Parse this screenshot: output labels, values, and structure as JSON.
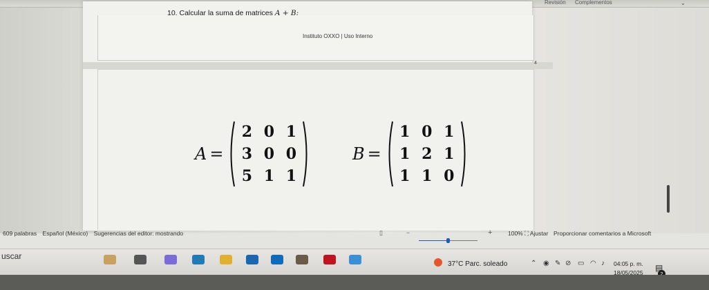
{
  "ribbon": {
    "tabs": [
      "Revisión",
      "Complementos"
    ]
  },
  "document": {
    "question": "10. Calcular la suma de matrices ",
    "question_math": "A + B:",
    "footer": "Instituto OXXO | Uso Interno",
    "page_number": "4",
    "matrices": [
      {
        "name": "A",
        "eq": "=",
        "rows": [
          [
            "2",
            "0",
            "1"
          ],
          [
            "3",
            "0",
            "0"
          ],
          [
            "5",
            "1",
            "1"
          ]
        ]
      },
      {
        "name": "B",
        "eq": "=",
        "rows": [
          [
            "1",
            "0",
            "1"
          ],
          [
            "1",
            "2",
            "1"
          ],
          [
            "1",
            "1",
            "0"
          ]
        ]
      }
    ]
  },
  "statusbar": {
    "words": "609 palabras",
    "language": "Español (México)",
    "editor": "Sugerencias del editor: mostrando",
    "zoom_minus": "−",
    "zoom_plus": "+",
    "zoom_level": 1.0,
    "zoom": "100%",
    "fit": "⛶ Ajustar",
    "feedback": "Proporcionar comentarios a Microsoft"
  },
  "taskbar": {
    "search": "uscar",
    "weather_temp": "37°C",
    "weather_desc": "Parc. soleado",
    "time": "04:05 p. m.",
    "date": "18/05/2025",
    "notification_count": "2",
    "apps": [
      {
        "icon": "search-highlight-icon",
        "color": "#c8a060"
      },
      {
        "icon": "task-view-icon",
        "color": "#555555"
      },
      {
        "icon": "copilot-icon",
        "color": "#7a6bd8"
      },
      {
        "icon": "edge-icon",
        "color": "#1f7ab8"
      },
      {
        "icon": "file-explorer-icon",
        "color": "#e0b030"
      },
      {
        "icon": "store-icon",
        "color": "#1a66b0"
      },
      {
        "icon": "outlook-icon",
        "color": "#0f6cbd"
      },
      {
        "icon": "game-icon",
        "color": "#6b5a45"
      },
      {
        "icon": "netflix-icon",
        "color": "#c1121f"
      },
      {
        "icon": "photos-icon",
        "color": "#3b8fd6"
      }
    ],
    "tray_icons": [
      "chevron-up-icon",
      "copilot-tray-icon",
      "pen-icon",
      "mute-icon",
      "battery-icon",
      "wifi-icon",
      "speaker-icon"
    ]
  }
}
